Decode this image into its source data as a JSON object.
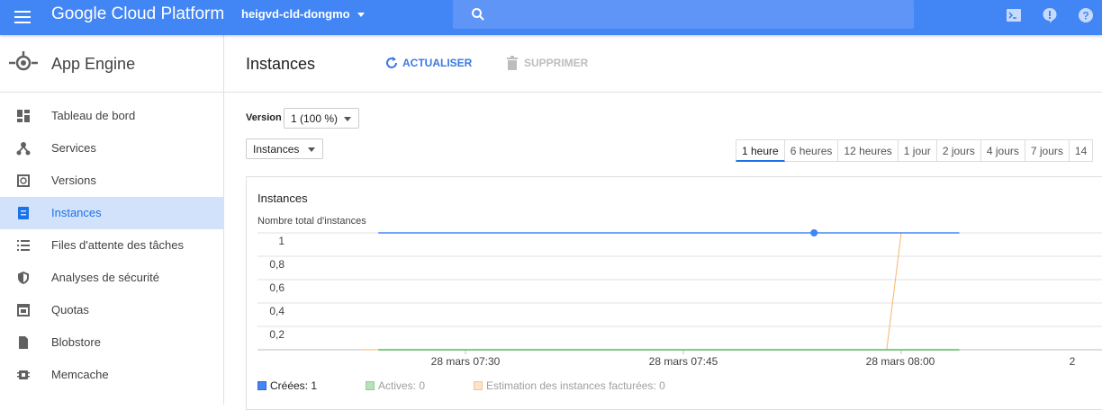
{
  "topbar": {
    "app_name": "Google Cloud Platform",
    "project": "heigvd-cld-dongmo",
    "search_icon": "search-icon",
    "icons": [
      "terminal-icon",
      "notification-icon",
      "help-icon"
    ],
    "color": "#4285f4"
  },
  "sidebar": {
    "title": "App Engine",
    "items": [
      {
        "label": "Tableau de bord",
        "icon": "dashboard-icon"
      },
      {
        "label": "Services",
        "icon": "services-icon"
      },
      {
        "label": "Versions",
        "icon": "versions-icon"
      },
      {
        "label": "Instances",
        "icon": "instances-icon",
        "active": true
      },
      {
        "label": "Files d'attente des tâches",
        "icon": "list-icon"
      },
      {
        "label": "Analyses de sécurité",
        "icon": "shield-icon"
      },
      {
        "label": "Quotas",
        "icon": "quotas-icon"
      },
      {
        "label": "Blobstore",
        "icon": "file-icon"
      },
      {
        "label": "Memcache",
        "icon": "memory-icon"
      }
    ]
  },
  "header": {
    "title": "Instances",
    "refresh_label": "ACTUALISER",
    "delete_label": "SUPPRIMER"
  },
  "filters": {
    "version_label": "Version",
    "version_value": "1 (100 %)",
    "metric_value": "Instances"
  },
  "time_ranges": [
    "1 heure",
    "6 heures",
    "12 heures",
    "1 jour",
    "2 jours",
    "4 jours",
    "7 jours",
    "14"
  ],
  "active_time_range": "1 heure",
  "chart_data": {
    "type": "line",
    "title": "Instances",
    "ylabel": "Nombre total d'instances",
    "ylim": [
      0,
      1
    ],
    "y_ticks": [
      "1",
      "0,8",
      "0,6",
      "0,4",
      "0,2"
    ],
    "x_ticks": [
      "28 mars 07:30",
      "28 mars 07:45",
      "28 mars 08:00",
      "2"
    ],
    "series": [
      {
        "name": "Créées: 1",
        "color": "#4285f4",
        "points": [
          [
            "07:24",
            1
          ],
          [
            "08:04",
            1
          ]
        ]
      },
      {
        "name": "Actives: 0",
        "color": "#57bb5a",
        "points": [
          [
            "07:24",
            0
          ],
          [
            "08:04",
            0
          ]
        ]
      },
      {
        "name": "Estimation des instances facturées: 0",
        "color": "#f7b36b",
        "points": [
          [
            "07:23",
            0
          ],
          [
            "07:59",
            0
          ],
          [
            "08:00",
            1
          ],
          [
            "08:04",
            1
          ]
        ]
      }
    ]
  }
}
